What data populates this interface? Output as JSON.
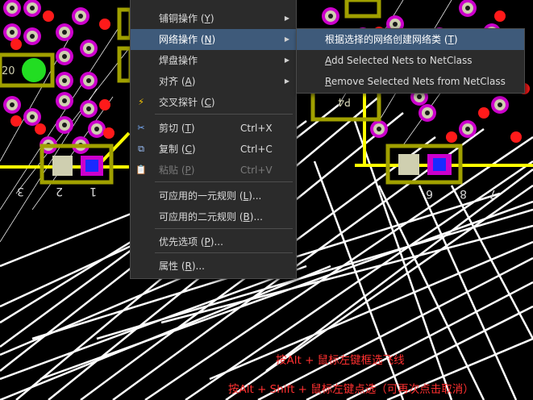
{
  "menu": {
    "items": [
      {
        "label": "铺铜操作",
        "accel": "Y",
        "submenu": true
      },
      {
        "label": "网络操作",
        "accel": "N",
        "submenu": true
      },
      {
        "label": "焊盘操作",
        "accel": "",
        "submenu": true
      },
      {
        "label": "对齐",
        "accel": "A",
        "submenu": true
      },
      {
        "label": "交叉探针",
        "accel": "C"
      },
      {
        "label": "剪切",
        "accel": "T",
        "shortcut": "Ctrl+X"
      },
      {
        "label": "复制",
        "accel": "C",
        "shortcut": "Ctrl+C"
      },
      {
        "label": "粘贴",
        "accel": "P",
        "shortcut": "Ctrl+V"
      },
      {
        "label": "可应用的一元规则",
        "accel": "L",
        "suffix": "..."
      },
      {
        "label": "可应用的二元规则",
        "accel": "B",
        "suffix": "..."
      },
      {
        "label": "优先选项",
        "accel": "P",
        "suffix": "..."
      },
      {
        "label": "属性",
        "accel": "R",
        "suffix": "..."
      }
    ]
  },
  "submenu": {
    "items": [
      {
        "label": "根据选择的网络创建网络类",
        "accel": "T"
      },
      {
        "label": "Add Selected Nets to NetClass",
        "accel": "A"
      },
      {
        "label": "Remove Selected Nets from NetClass",
        "accel": "R"
      }
    ]
  },
  "pcb": {
    "labels_left": [
      "3",
      "2",
      "1"
    ],
    "labels_right": [
      "6",
      "8",
      "7"
    ],
    "designator_left": "20",
    "designator_mid": "P4"
  },
  "hints": {
    "line1": "按Alt + 鼠标左键框选飞线",
    "line2": "按Alt + Shift + 鼠标左键点选（可再次点击取消）"
  }
}
